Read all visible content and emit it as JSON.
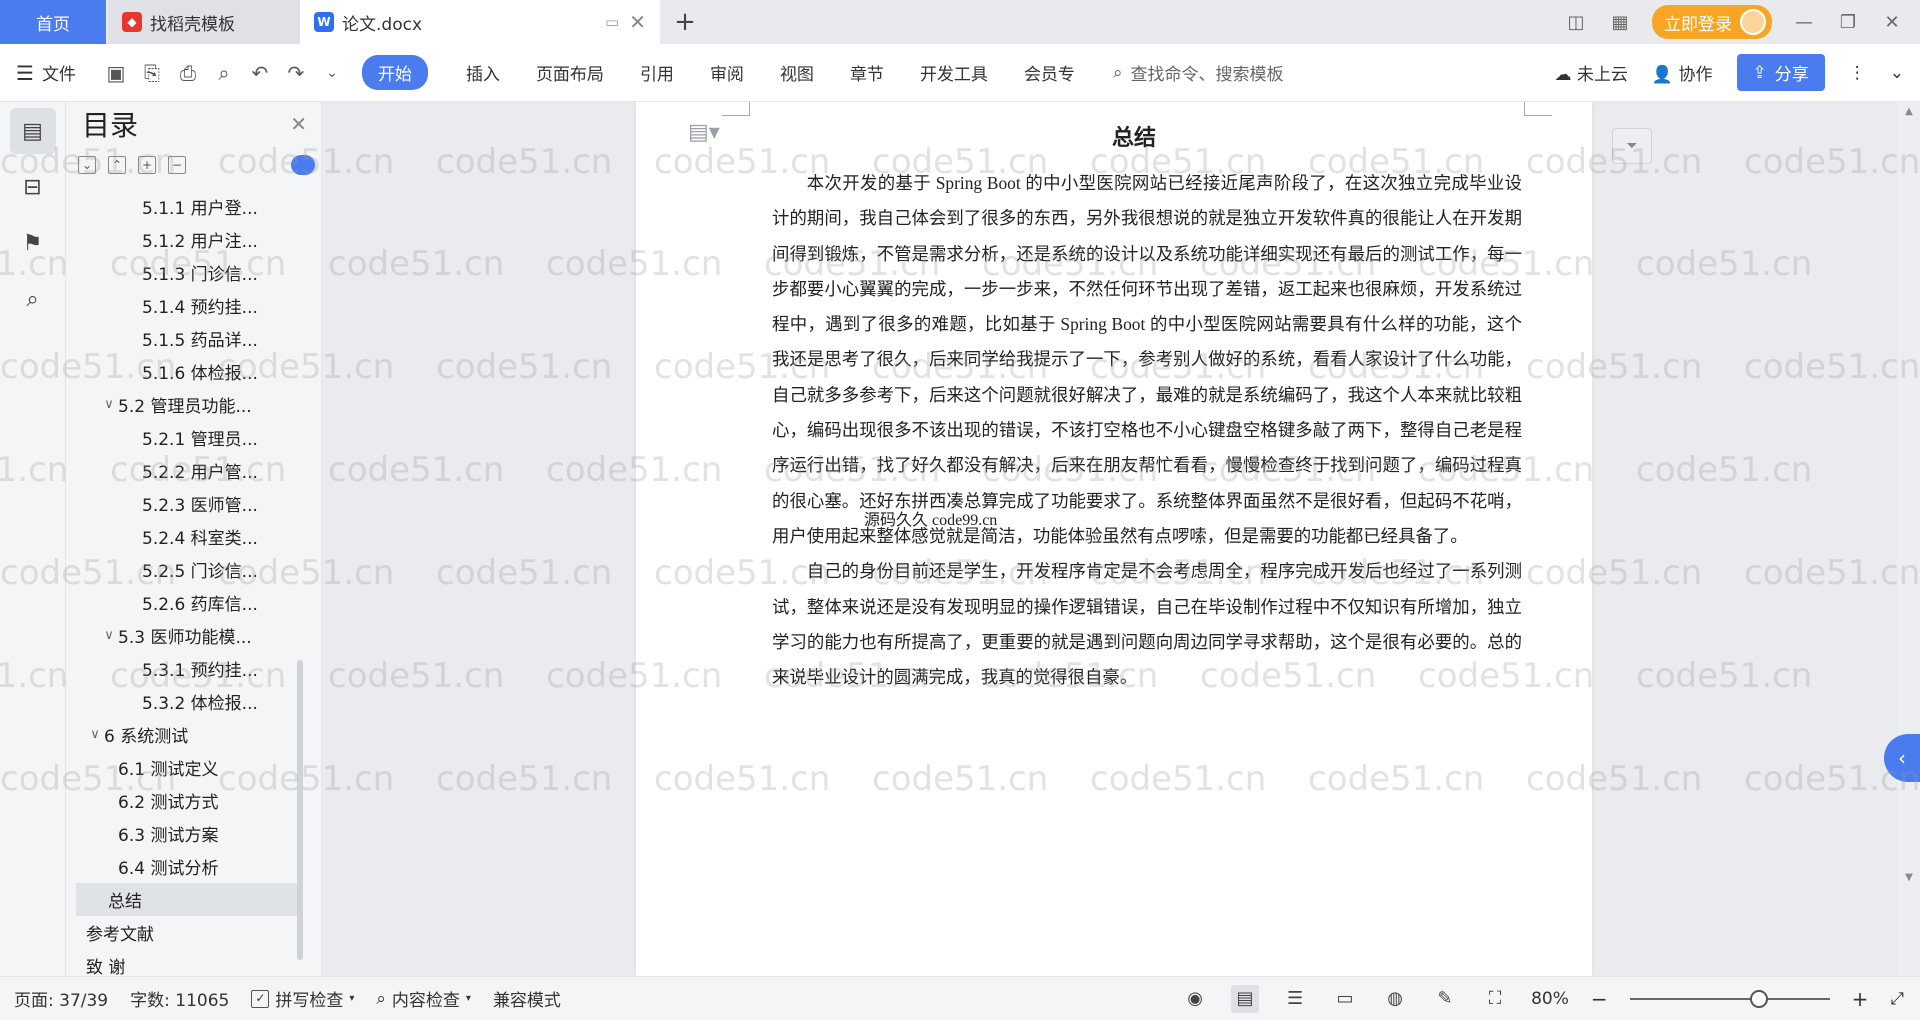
{
  "tabbar": {
    "home_label": "首页",
    "find_tab_label": "找稻壳模板",
    "doc_tab_label": "论文.docx",
    "login_label": "立即登录"
  },
  "toolbar": {
    "file_label": "文件",
    "menus": [
      "开始",
      "插入",
      "页面布局",
      "引用",
      "审阅",
      "视图",
      "章节",
      "开发工具",
      "会员专"
    ],
    "search_placeholder": "查找命令、搜索模板",
    "cloud_label": "未上云",
    "collab_label": "协作",
    "share_label": "分享"
  },
  "toc": {
    "title": "目录",
    "items": [
      {
        "label": "5.1.1 用户登...",
        "level": "l3"
      },
      {
        "label": "5.1.2 用户注...",
        "level": "l3"
      },
      {
        "label": "5.1.3 门诊信...",
        "level": "l3"
      },
      {
        "label": "5.1.4 预约挂...",
        "level": "l3"
      },
      {
        "label": "5.1.5 药品详...",
        "level": "l3"
      },
      {
        "label": "5.1.6 体检报...",
        "level": "l3"
      },
      {
        "label": "5.2  管理员功能...",
        "level": "l2"
      },
      {
        "label": "5.2.1 管理员...",
        "level": "l3"
      },
      {
        "label": "5.2.2 用户管...",
        "level": "l3"
      },
      {
        "label": "5.2.3 医师管...",
        "level": "l3"
      },
      {
        "label": "5.2.4 科室类...",
        "level": "l3"
      },
      {
        "label": "5.2.5 门诊信...",
        "level": "l3"
      },
      {
        "label": "5.2.6 药库信...",
        "level": "l3"
      },
      {
        "label": "5.3  医师功能模...",
        "level": "l2"
      },
      {
        "label": "5.3.1 预约挂...",
        "level": "l3"
      },
      {
        "label": "5.3.2 体检报...",
        "level": "l3"
      },
      {
        "label": "6  系统测试",
        "level": "l1"
      },
      {
        "label": "6.1  测试定义",
        "level": "l2n"
      },
      {
        "label": "6.2  测试方式",
        "level": "l2n"
      },
      {
        "label": "6.3  测试方案",
        "level": "l2n"
      },
      {
        "label": "6.4  测试分析",
        "level": "l2n"
      },
      {
        "label": "总结",
        "level": "top-sel"
      },
      {
        "label": "参考文献",
        "level": "l1"
      },
      {
        "label": "致    谢",
        "level": "l1"
      }
    ]
  },
  "document": {
    "title": "总结",
    "paragraphs": [
      "本次开发的基于 Spring Boot 的中小型医院网站已经接近尾声阶段了，在这次独立完成毕业设计的期间，我自己体会到了很多的东西，另外我很想说的就是独立开发软件真的很能让人在开发期间得到锻炼，不管是需求分析，还是系统的设计以及系统功能详细实现还有最后的测试工作，每一步都要小心翼翼的完成，一步一步来，不然任何环节出现了差错，返工起来也很麻烦，开发系统过程中，遇到了很多的难题，比如基于 Spring Boot 的中小型医院网站需要具有什么样的功能，这个我还是思考了很久，后来同学给我提示了一下，参考别人做好的系统，看看人家设计了什么功能，自己就多多参考下，后来这个问题就很好解决了，最难的就是系统编码了，我这个人本来就比较粗心，编码出现很多不该出现的错误，不该打空格也不小心键盘空格键多敲了两下，整得自己老是程序运行出错，找了好久都没有解决，后来在朋友帮忙看看，慢慢检查终于找到问题了，编码过程真的很心塞。还好东拼西凑总算完成了功能要求了。系统整体界面虽然不是很好看，但起码不花哨，用户使用起来整体感觉就是简洁，功能体验虽然有点啰嗦，但是需要的功能都已经具备了。",
      "自己的身份目前还是学生，开发程序肯定是不会考虑周全，程序完成开发后也经过了一系列测试，整体来说还是没有发现明显的操作逻辑错误，自己在毕设制作过程中不仅知识有所增加，独立学习的能力也有所提高了，更重要的就是遇到问题向周边同学寻求帮助，这个是很有必要的。总的来说毕业设计的圆满完成，我真的觉得很自豪。"
    ],
    "overlay_text": "源码久久 code99.cn"
  },
  "watermark": "code51.cn",
  "status": {
    "page": "页面: 37/39",
    "words": "字数: 11065",
    "spell": "拼写检查",
    "content": "内容检查",
    "compat": "兼容模式",
    "zoom": "80%"
  },
  "colors": {
    "accent": "#4a7cf0",
    "login": "#f6a623"
  }
}
